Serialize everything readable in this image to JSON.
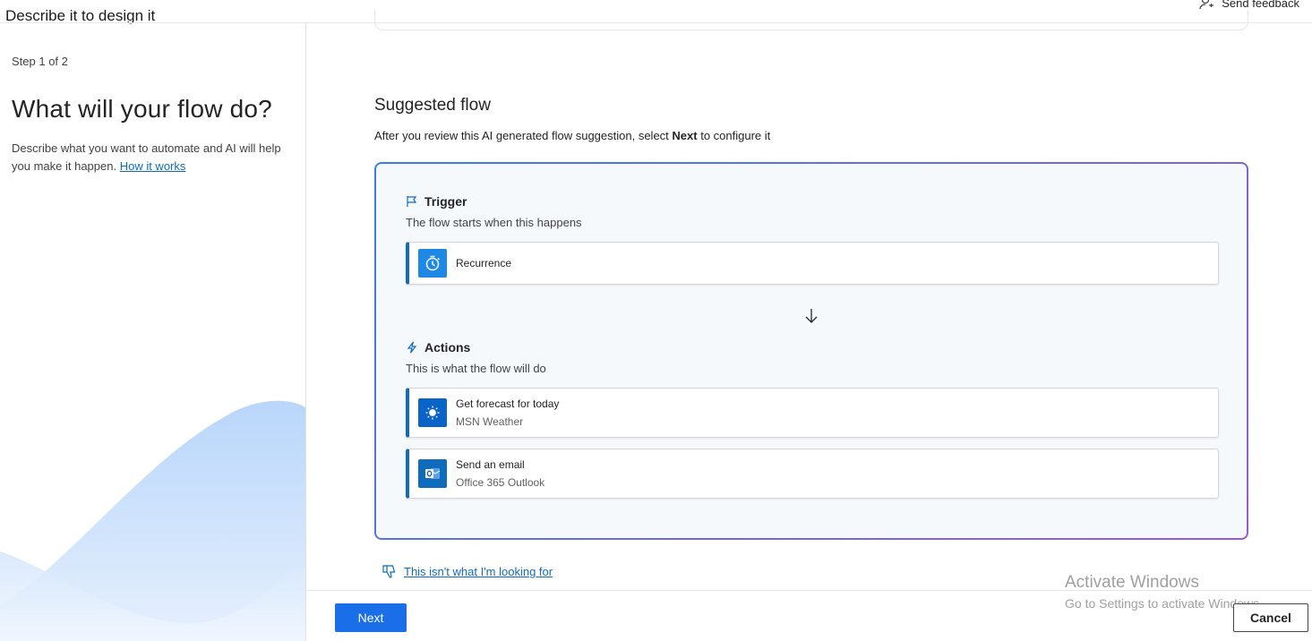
{
  "header": {
    "title": "Describe it to design it",
    "feedback_label": "Send feedback"
  },
  "left": {
    "step": "Step 1 of 2",
    "heading": "What will your flow do?",
    "description": "Describe what you want to automate and AI will help you make it happen.",
    "link": "How it works"
  },
  "main": {
    "title": "Suggested flow",
    "subtitle_before": "After you review this AI generated flow suggestion, select ",
    "subtitle_bold": "Next",
    "subtitle_after": " to configure it",
    "trigger": {
      "heading": "Trigger",
      "subtitle": "The flow starts when this happens",
      "card": {
        "name": "Recurrence",
        "icon": "alarm-clock-icon",
        "color": "#1e88e5"
      }
    },
    "actions": {
      "heading": "Actions",
      "subtitle": "This is what the flow will do",
      "cards": [
        {
          "name": "Get forecast for today",
          "connector": "MSN Weather",
          "icon": "sun-icon",
          "color": "#0a64c8"
        },
        {
          "name": "Send an email",
          "connector": "Office 365 Outlook",
          "icon": "outlook-icon",
          "color": "#0f6cbd"
        }
      ]
    },
    "feedback_link": "This isn't what I'm looking for"
  },
  "footer": {
    "next_label": "Next",
    "cancel_label": "Cancel"
  },
  "watermark": {
    "line1": "Activate Windows",
    "line2": "Go to Settings to activate Windows."
  },
  "colors": {
    "accent": "#0f6cbd",
    "primary_button": "#1a6fe8",
    "border_gradient_start": "#3a7ee0",
    "border_gradient_end": "#9b5ad6"
  }
}
